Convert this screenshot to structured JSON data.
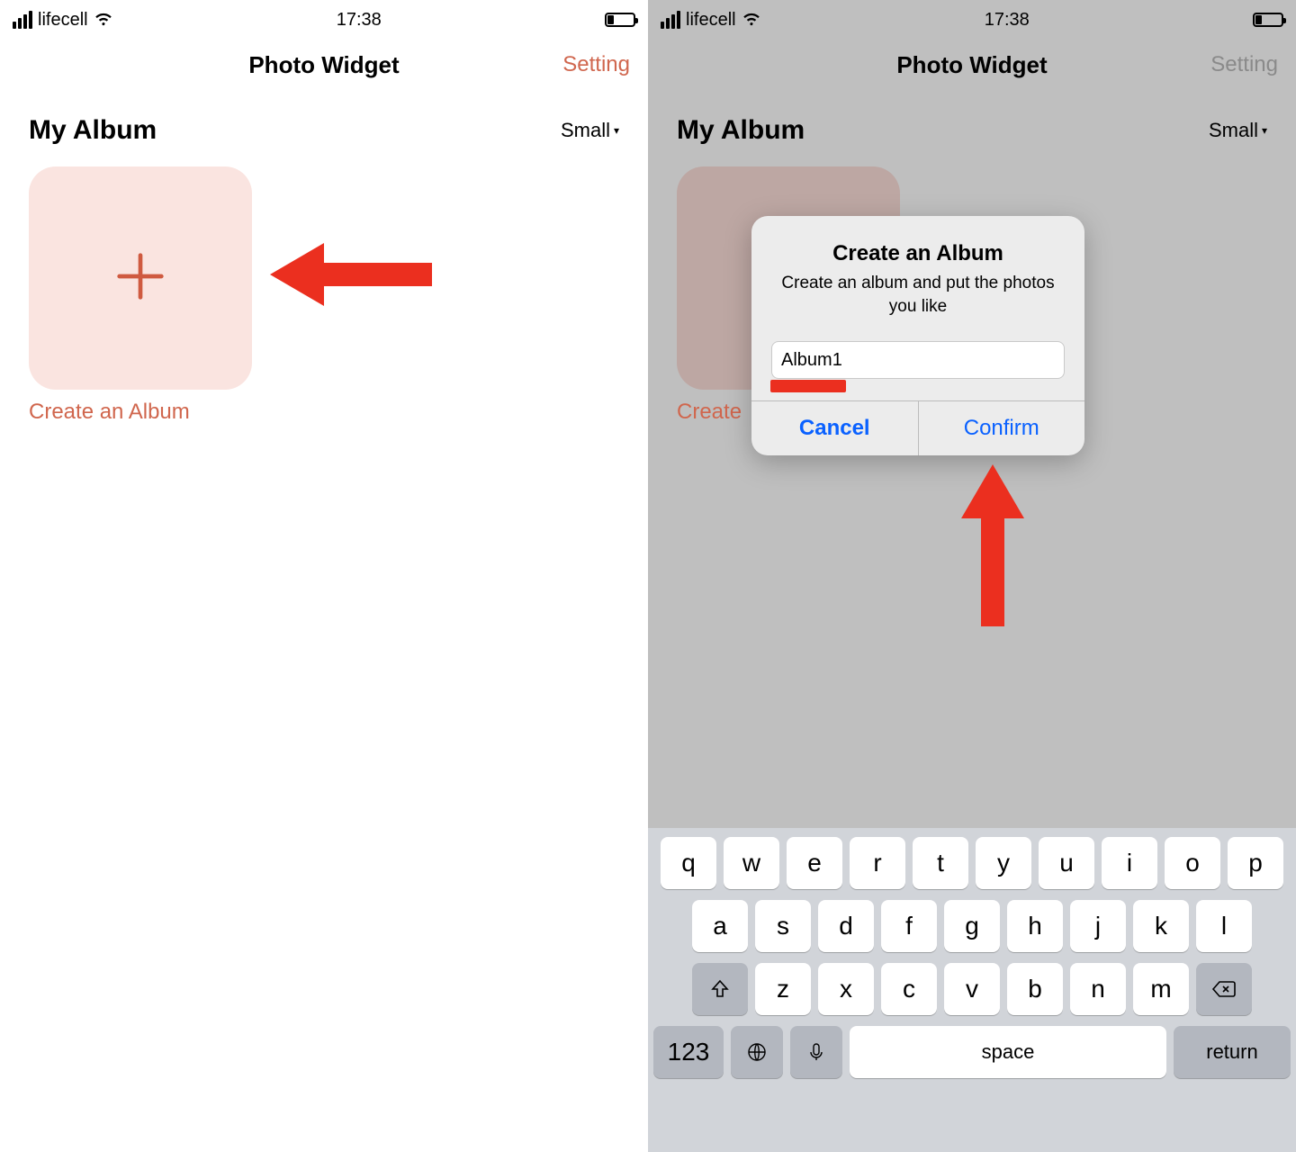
{
  "status": {
    "carrier": "lifecell",
    "time": "17:38"
  },
  "nav": {
    "title": "Photo Widget",
    "action": "Setting"
  },
  "section": {
    "title": "My Album",
    "size_label": "Small"
  },
  "tile": {
    "caption": "Create an Album"
  },
  "tile2": {
    "caption": "Create"
  },
  "dialog": {
    "title": "Create an Album",
    "message": "Create an album and put the photos you like",
    "input_value": "Album1",
    "cancel": "Cancel",
    "confirm": "Confirm"
  },
  "keyboard": {
    "row1": [
      "q",
      "w",
      "e",
      "r",
      "t",
      "y",
      "u",
      "i",
      "o",
      "p"
    ],
    "row2": [
      "a",
      "s",
      "d",
      "f",
      "g",
      "h",
      "j",
      "k",
      "l"
    ],
    "row3": [
      "z",
      "x",
      "c",
      "v",
      "b",
      "n",
      "m"
    ],
    "numbers": "123",
    "space": "space",
    "return": "return"
  }
}
